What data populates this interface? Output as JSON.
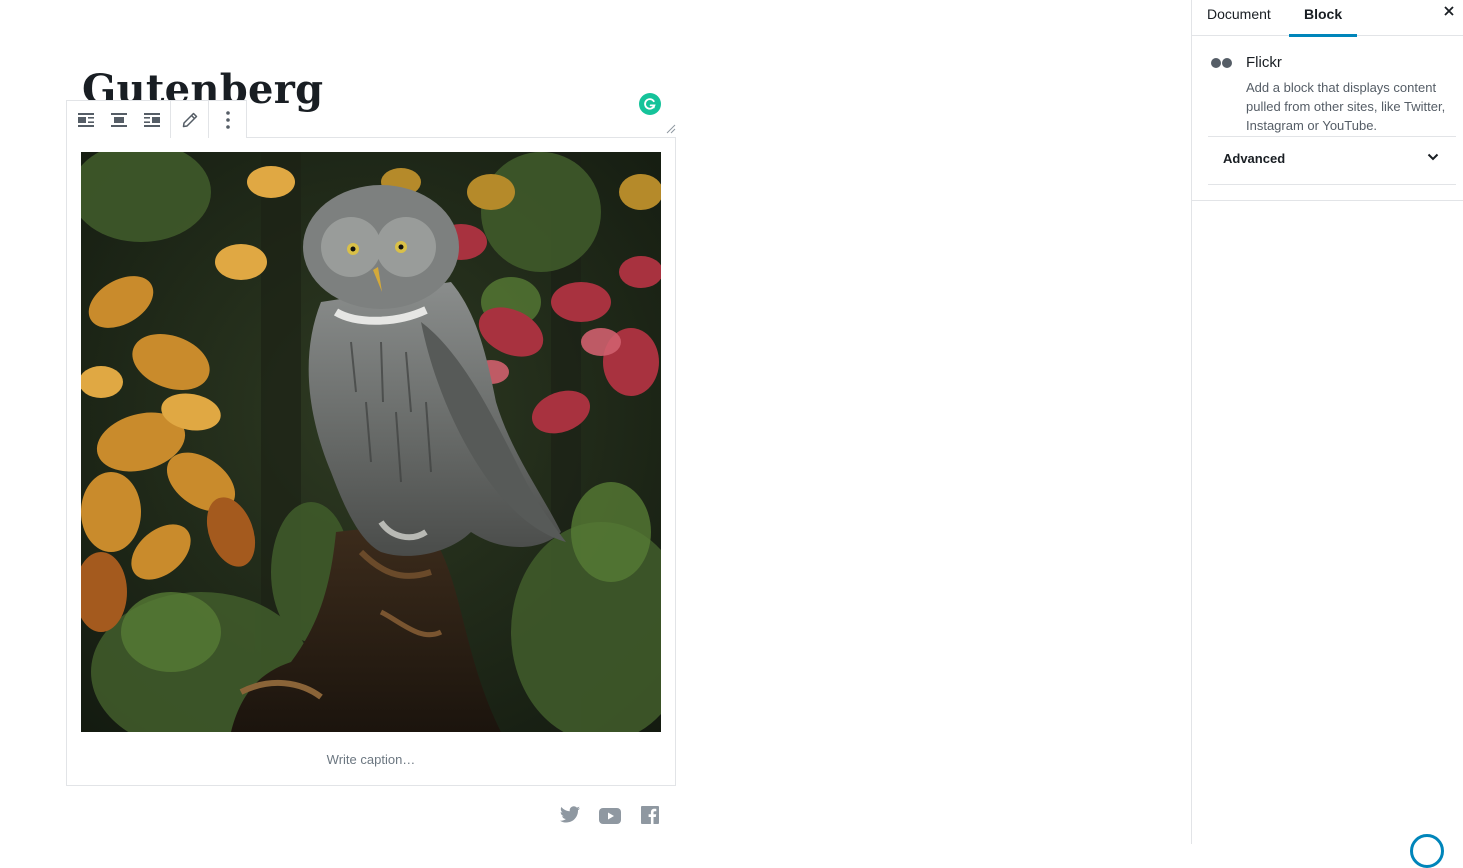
{
  "post": {
    "title": "Gutenberg"
  },
  "toolbar": {
    "buttons": [
      {
        "name": "align-left-icon",
        "label": "Align left"
      },
      {
        "name": "align-center-icon",
        "label": "Align center"
      },
      {
        "name": "align-right-icon",
        "label": "Align right"
      },
      {
        "name": "edit-url-icon",
        "label": "Edit URL"
      },
      {
        "name": "more-options-icon",
        "label": "More options"
      }
    ]
  },
  "embed": {
    "provider": "Flickr",
    "image_subject": "Great grey owl perched on a tree stump among autumn foliage",
    "caption_placeholder": "Write caption…"
  },
  "social_icons": [
    "twitter-icon",
    "youtube-icon",
    "facebook-icon"
  ],
  "sidebar": {
    "tabs": [
      {
        "label": "Document",
        "active": false
      },
      {
        "label": "Block",
        "active": true
      }
    ],
    "block": {
      "name": "Flickr",
      "description": "Add a block that displays content pulled from other sites, like Twitter, Instagram or YouTube."
    },
    "panels": [
      {
        "label": "Advanced",
        "expanded": false
      }
    ]
  },
  "colors": {
    "accent": "#0085ba",
    "grammarly": "#15c39a",
    "border": "#e2e4e7",
    "icon_gray": "#555d66"
  }
}
